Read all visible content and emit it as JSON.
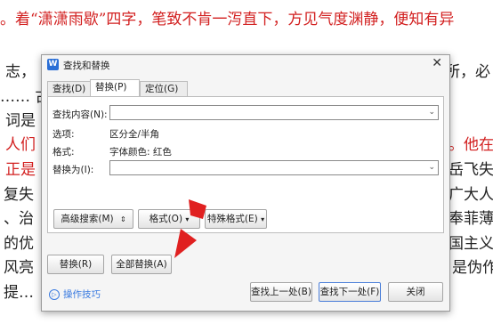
{
  "document": {
    "lines": [
      {
        "id": "line-1",
        "segments": [
          {
            "text": "。着“潇潇雨歇”四字，笔致不肯一泻直下，方见气度渊静，便知有异",
            "color": "#d21f1f"
          }
        ]
      },
      {
        "id": "line-2",
        "segments": [
          {
            "text": "志，",
            "color": "#222"
          }
        ]
      },
      {
        "id": "line-3",
        "segments": [
          {
            "text": "…… 古诗",
            "color": "#222"
          }
        ]
      },
      {
        "id": "line-4",
        "segments": [
          {
            "text": "词是",
            "color": "#222"
          }
        ]
      },
      {
        "id": "line-5",
        "segments": [
          {
            "text": "人们",
            "color": "#d21f1f"
          }
        ]
      },
      {
        "id": "line-6",
        "segments": [
          {
            "text": "正是",
            "color": "#d21f1f"
          }
        ]
      },
      {
        "id": "line-7",
        "segments": [
          {
            "text": "复失",
            "color": "#222"
          }
        ]
      },
      {
        "id": "line-8",
        "segments": [
          {
            "text": "、治",
            "color": "#222"
          }
        ]
      },
      {
        "id": "line-9",
        "segments": [
          {
            "text": "的优",
            "color": "#222"
          }
        ]
      },
      {
        "id": "line-10",
        "segments": [
          {
            "text": "风亮",
            "color": "#222"
          }
        ]
      },
      {
        "id": "line-11",
        "segments": [
          {
            "text": "提…",
            "color": "#222"
          }
        ]
      }
    ],
    "right_fragments": [
      {
        "id": "r2",
        "text": "所，必",
        "color": "#222"
      },
      {
        "id": "r5",
        "text": "。他在",
        "color": "#d21f1f"
      },
      {
        "id": "r6",
        "text": "岳飞失",
        "color": "#222"
      },
      {
        "id": "r7",
        "text": "广大人",
        "color": "#222"
      },
      {
        "id": "r8",
        "text": "奉菲薄",
        "color": "#222"
      },
      {
        "id": "r9",
        "text": "国主义",
        "color": "#222"
      },
      {
        "id": "r10",
        "text": "是伪作或",
        "color": "#222"
      }
    ]
  },
  "dialog": {
    "title": "查找和替换",
    "app_icon": "wps-writer-icon",
    "tabs": [
      {
        "label": "查找(D)",
        "active": false
      },
      {
        "label": "替换(P)",
        "active": true
      },
      {
        "label": "定位(G)",
        "active": false
      }
    ],
    "find": {
      "label": "查找内容(N):",
      "value": ""
    },
    "options": {
      "label": "选项:",
      "value": "区分全/半角"
    },
    "format": {
      "label": "格式:",
      "value": "字体颜色: 红色"
    },
    "replace": {
      "label": "替换为(I):",
      "value": ""
    },
    "buttons": {
      "advanced": "高级搜索(M)",
      "format": "格式(O)",
      "special": "特殊格式(E)",
      "replace": "替换(R)",
      "replace_all": "全部替换(A)",
      "find_prev": "查找上一处(B)",
      "find_next": "查找下一处(F)",
      "close": "关闭"
    },
    "tips": "操作技巧"
  },
  "annotation": {
    "color": "#e02020"
  }
}
